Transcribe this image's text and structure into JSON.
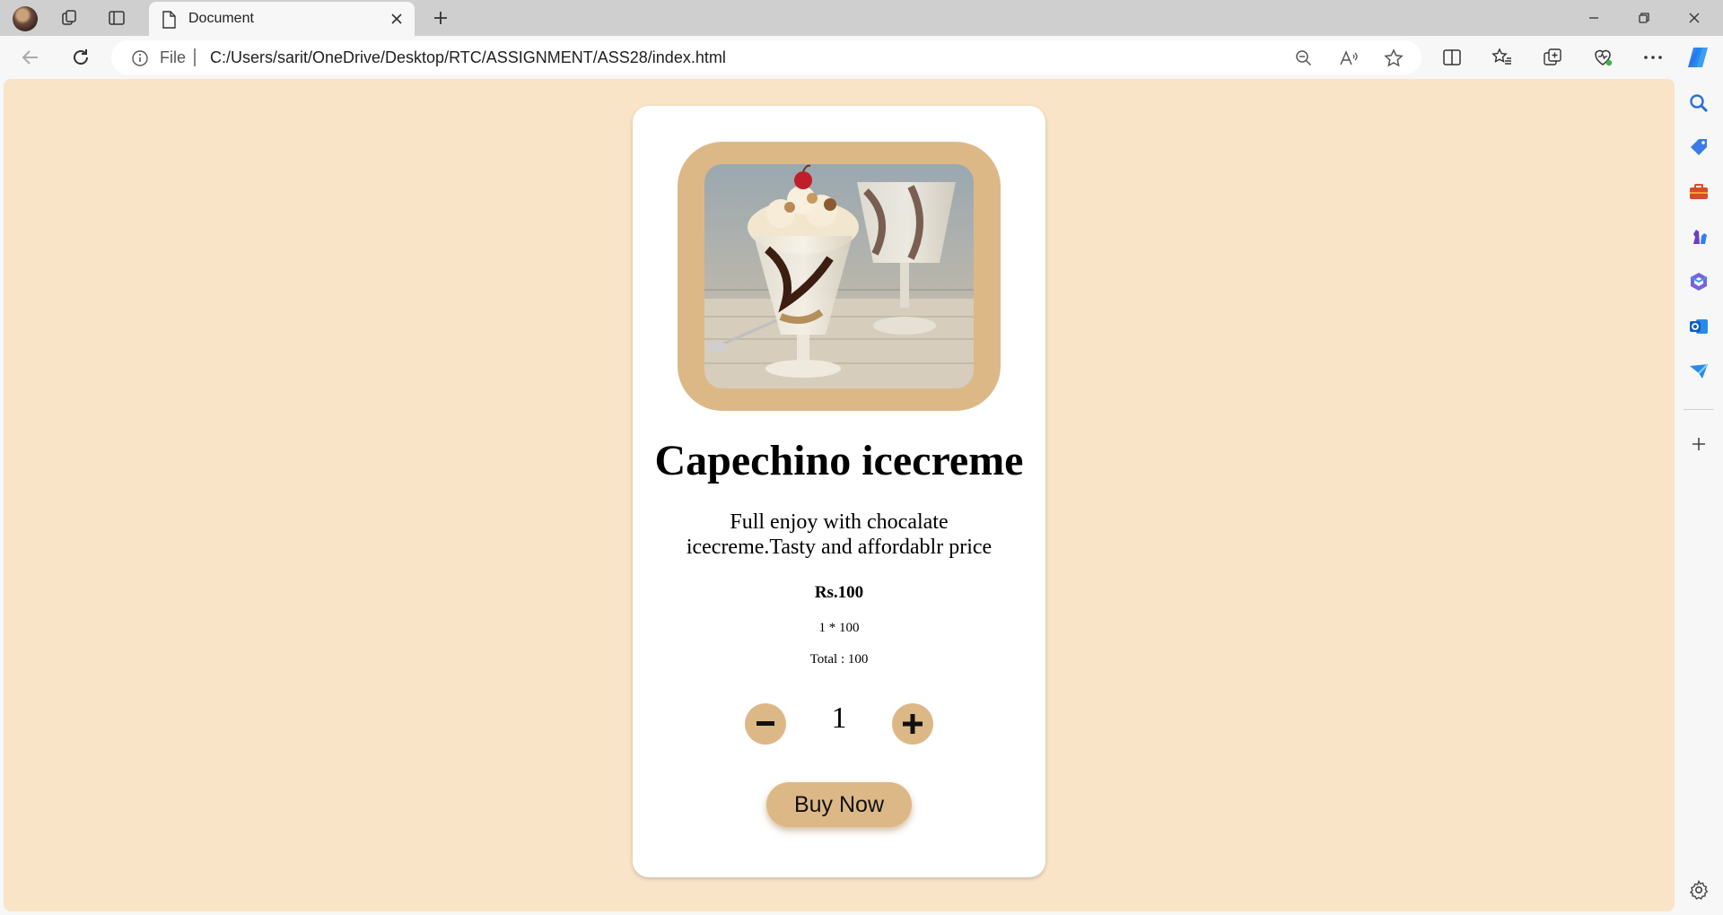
{
  "browser": {
    "tab_title": "Document",
    "address": {
      "scheme_label": "File",
      "url": "C:/Users/sarit/OneDrive/Desktop/RTC/ASSIGNMENT/ASS28/index.html"
    },
    "icons": {
      "tab_bar": [
        "profile-avatar",
        "workspaces-icon",
        "tab-actions-icon",
        "document-icon",
        "close-icon",
        "new-tab-icon"
      ],
      "window_controls": [
        "minimize-icon",
        "restore-icon",
        "close-window-icon"
      ],
      "nav": [
        "back-icon",
        "refresh-icon",
        "info-icon"
      ],
      "address_bar": [
        "zoom-out-icon",
        "read-aloud-icon",
        "favorite-star-icon"
      ],
      "toolbar": [
        "split-screen-icon",
        "favorites-icon",
        "collections-icon",
        "browser-essentials-icon",
        "more-menu-icon",
        "copilot-icon"
      ],
      "sidebar": [
        "search-icon",
        "shopping-tag-icon",
        "tools-briefcase-icon",
        "games-icon",
        "microsoft-365-icon",
        "outlook-icon",
        "drop-icon",
        "add-icon",
        "settings-icon"
      ]
    }
  },
  "product": {
    "title": "Capechino icecreme",
    "description": "Full enjoy with chocalate icecreme.Tasty and affordablr price",
    "price": "Rs.100",
    "calc": "1 * 100",
    "total": "Total : 100",
    "quantity": "1",
    "buy_label": "Buy Now"
  },
  "colors": {
    "page_background": "#f9e4c8",
    "accent": "#ddb887",
    "card": "#ffffff"
  }
}
